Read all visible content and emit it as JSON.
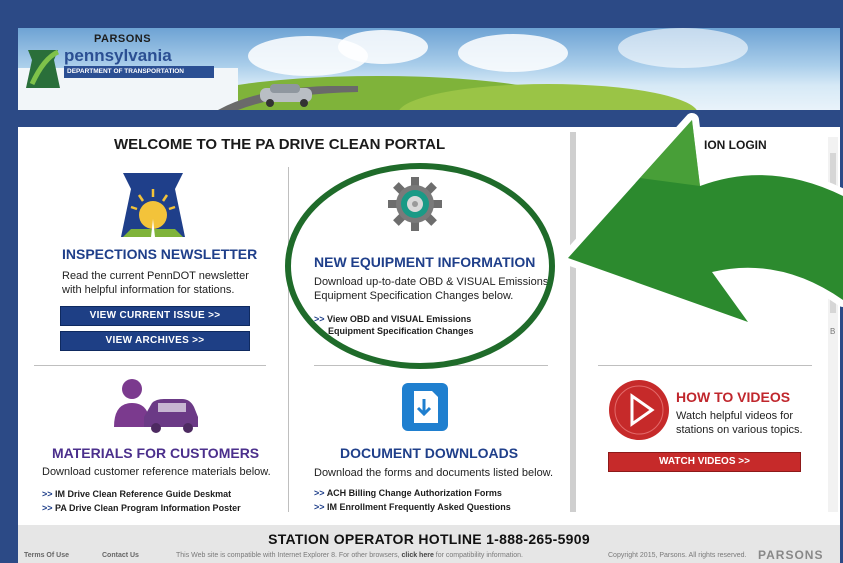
{
  "header": {
    "brand": "PARSONS",
    "state": "pennsylvania",
    "department": "DEPARTMENT OF TRANSPORTATION"
  },
  "welcome_title": "WELCOME TO THE PA DRIVE CLEAN PORTAL",
  "login_title": "ION LOGIN",
  "newsletter": {
    "title": "INSPECTIONS NEWSLETTER",
    "desc_line1": "Read the current PennDOT newsletter",
    "desc_line2": "with helpful information for stations.",
    "view_current": "VIEW CURRENT ISSUE >>",
    "view_archives": "VIEW ARCHIVES >>"
  },
  "equipment": {
    "title": "NEW EQUIPMENT INFORMATION",
    "desc_line1": "Download up-to-date OBD & VISUAL Emissions",
    "desc_line2": "Equipment Specification Changes below.",
    "link_prefix": ">>",
    "link_line1": "View OBD and VISUAL Emissions",
    "link_line2": "Equipment Specification Changes"
  },
  "materials": {
    "title": "MATERIALS FOR CUSTOMERS",
    "desc": "Download customer reference materials below.",
    "links": [
      {
        "prefix": ">>",
        "label": "IM Drive Clean Reference Guide Deskmat"
      },
      {
        "prefix": ">>",
        "label": "PA Drive Clean Program Information Poster"
      }
    ]
  },
  "documents": {
    "title": "DOCUMENT DOWNLOADS",
    "desc": "Download the forms and documents listed below.",
    "links": [
      {
        "prefix": ">>",
        "label": "ACH Billing Change Authorization Forms"
      },
      {
        "prefix": ">>",
        "label": "IM Enrollment Frequently Asked Questions"
      }
    ]
  },
  "videos": {
    "title": "HOW TO VIDEOS",
    "desc_line1": "Watch helpful videos for",
    "desc_line2": "stations on various topics.",
    "button": "WATCH VIDEOS >>"
  },
  "scroll_letter": "B",
  "hotline": "STATION OPERATOR HOTLINE  1-888-265-5909",
  "footer": {
    "terms": "Terms Of Use",
    "contact": "Contact Us",
    "compat_pre": "This Web site is compatible with Internet Explorer 8. For other browsers,",
    "compat_link": "click here",
    "compat_post": "for compatibility information.",
    "copyright": "Copyright 2015, Parsons. All rights reserved.",
    "brand": "PARSONS"
  },
  "colors": {
    "navy": "#2c4a86",
    "accent_blue": "#1f3f8a",
    "accent_red": "#c0272d",
    "annotation_green": "#1f6b2a"
  },
  "icons": [
    "keystone-icon",
    "gear-icon",
    "customer-car-icon",
    "document-download-icon",
    "play-icon",
    "annotation-arrow-icon",
    "annotation-circle-icon"
  ]
}
